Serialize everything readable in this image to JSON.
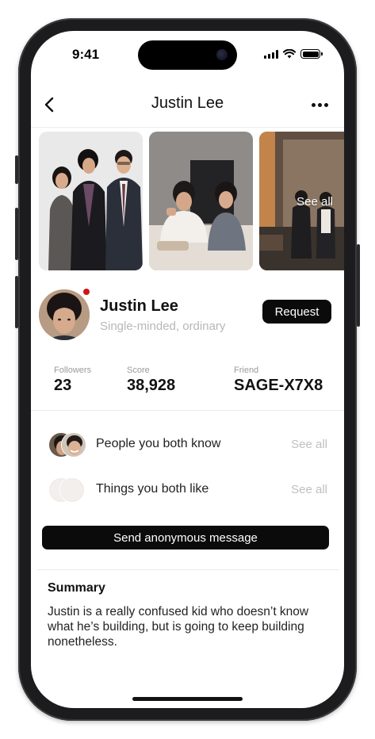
{
  "status_bar": {
    "time": "9:41"
  },
  "nav": {
    "title": "Justin Lee",
    "back_icon": "chevron-left-icon",
    "more_icon": "ellipsis-icon"
  },
  "photos": {
    "see_all_label": "See all",
    "count_visible": 3
  },
  "profile": {
    "name": "Justin Lee",
    "bio": "Single-minded, ordinary",
    "online_color": "#d0141c",
    "request_label": "Request"
  },
  "stats": [
    {
      "label": "Followers",
      "value": "23"
    },
    {
      "label": "Score",
      "value": "38,928"
    },
    {
      "label": "Friend",
      "value": "SAGE-X7X8"
    }
  ],
  "mutuals": [
    {
      "label": "People you both know",
      "see_all": "See all"
    },
    {
      "label": "Things you both like",
      "see_all": "See all"
    }
  ],
  "anon_button_label": "Send anonymous message",
  "summary": {
    "title": "Summary",
    "text": "Justin is a really confused kid who doesn’t know what he’s building, but is going to keep building nonetheless."
  },
  "colors": {
    "primary_button": "#0b0b0b",
    "muted_text": "#b7b7b7"
  }
}
